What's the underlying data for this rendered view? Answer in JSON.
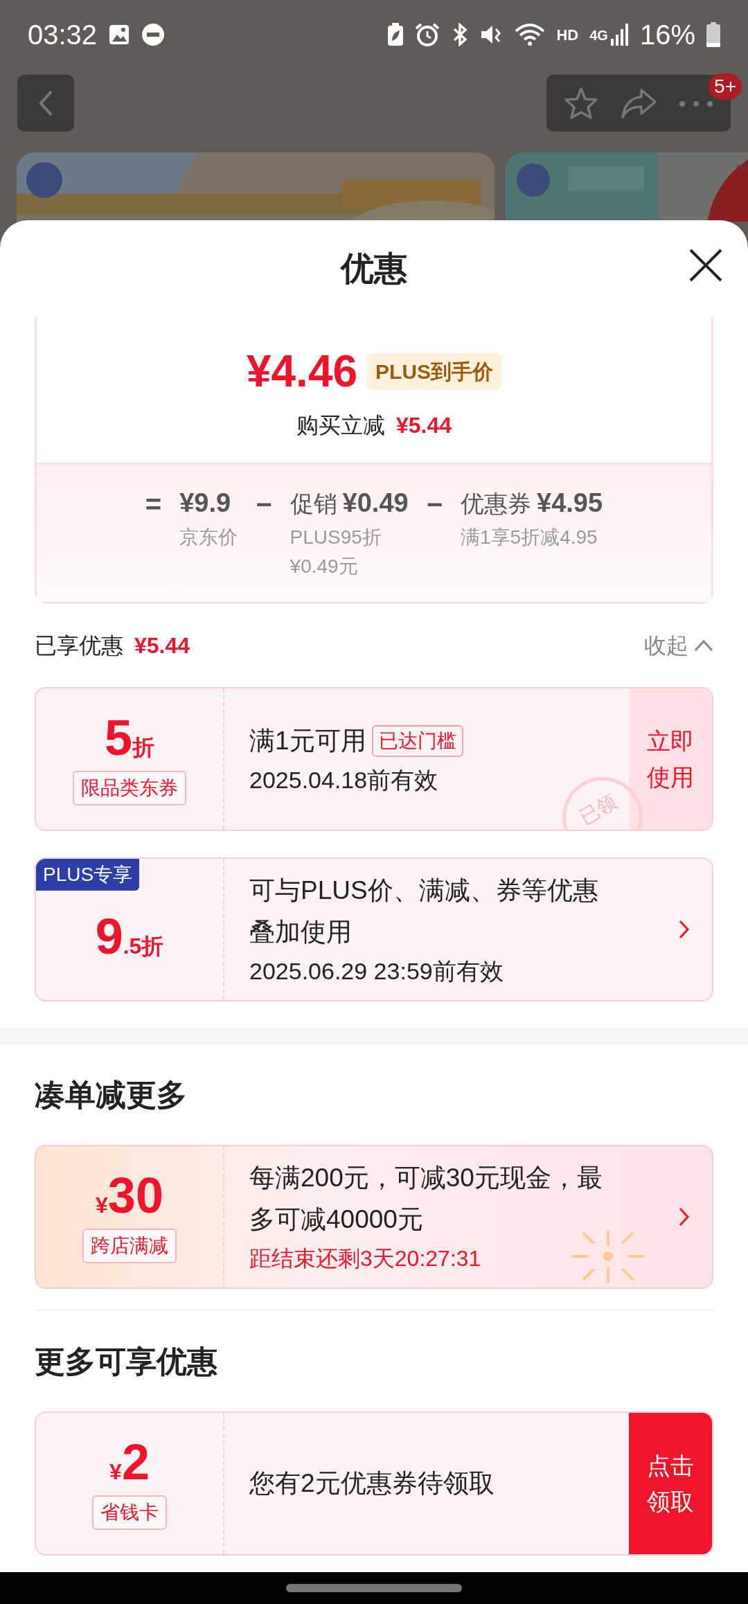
{
  "status_bar": {
    "time": "03:32",
    "network": "4G",
    "hd": "HD",
    "battery": "16%"
  },
  "top_bar": {
    "badge": "5+"
  },
  "sheet": {
    "title": "优惠",
    "summary": {
      "price": "¥4.46",
      "price_tag": "PLUS到手价",
      "saving_label": "购买立减",
      "saving": "¥5.44",
      "breakdown": [
        {
          "operator": "=",
          "amount": "¥9.9",
          "notes": [
            "京东价"
          ]
        },
        {
          "operator": "−",
          "label": "促销",
          "amount": "¥0.49",
          "notes": [
            "PLUS95折",
            "¥0.49元"
          ]
        },
        {
          "operator": "−",
          "label": "优惠券",
          "amount": "¥4.95",
          "notes": [
            "满1享5折减4.95"
          ]
        }
      ]
    },
    "enjoyed": {
      "label": "已享优惠",
      "amount": "¥5.44",
      "toggle": "收起",
      "expanded": true
    },
    "applied_coupons": [
      {
        "kind": "coupon",
        "value": "5",
        "suffix": "折",
        "tag": "限品类东券",
        "title": "满1元可用",
        "title_badge": "已达门槛",
        "validity": "2025.04.18前有效",
        "action": {
          "label": "立即使用",
          "kind": "use"
        },
        "stamp": "已领"
      },
      {
        "kind": "coupon",
        "ribbon": "PLUS专享",
        "value": "9",
        "suffix": ".5折",
        "title": "可与PLUS价、满减、券等优惠叠加使用",
        "validity": "2025.06.29 23:59前有效",
        "chevron": true
      }
    ],
    "sections": [
      {
        "title": "凑单减更多",
        "offers": [
          {
            "kind": "festive",
            "prefix": "¥",
            "value": "30",
            "tag": "跨店满减",
            "title": "每满200元，可减30元现金，最多可减40000元",
            "countdown": "距结束还剩3天20:27:31",
            "chevron": true
          }
        ]
      },
      {
        "title": "更多可享优惠",
        "offers": [
          {
            "kind": "coupon",
            "prefix": "¥",
            "value": "2",
            "tag": "省钱卡",
            "title": "您有2元优惠券待领取",
            "action": {
              "label": "点击领取",
              "kind": "claim"
            }
          }
        ]
      }
    ]
  }
}
